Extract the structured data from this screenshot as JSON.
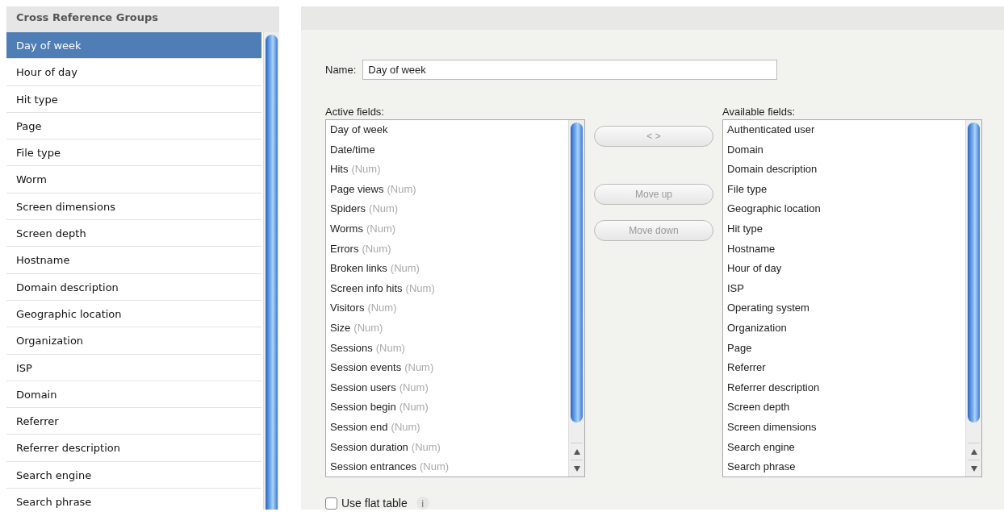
{
  "groups_panel": {
    "title": "Cross Reference Groups",
    "items": [
      {
        "label": "Day of week",
        "selected": true
      },
      {
        "label": "Hour of day",
        "selected": false
      },
      {
        "label": "Hit type",
        "selected": false
      },
      {
        "label": "Page",
        "selected": false
      },
      {
        "label": "File type",
        "selected": false
      },
      {
        "label": "Worm",
        "selected": false
      },
      {
        "label": "Screen dimensions",
        "selected": false
      },
      {
        "label": "Screen depth",
        "selected": false
      },
      {
        "label": "Hostname",
        "selected": false
      },
      {
        "label": "Domain description",
        "selected": false
      },
      {
        "label": "Geographic location",
        "selected": false
      },
      {
        "label": "Organization",
        "selected": false
      },
      {
        "label": "ISP",
        "selected": false
      },
      {
        "label": "Domain",
        "selected": false
      },
      {
        "label": "Referrer",
        "selected": false
      },
      {
        "label": "Referrer description",
        "selected": false
      },
      {
        "label": "Search engine",
        "selected": false
      },
      {
        "label": "Search phrase",
        "selected": false
      }
    ]
  },
  "editor": {
    "name_label": "Name:",
    "name_value": "Day of week",
    "active_label": "Active fields:",
    "active_fields": [
      {
        "label": "Day of week"
      },
      {
        "label": "Date/time"
      },
      {
        "label": "Hits",
        "suffix": "(Num)"
      },
      {
        "label": "Page views",
        "suffix": "(Num)"
      },
      {
        "label": "Spiders",
        "suffix": "(Num)"
      },
      {
        "label": "Worms",
        "suffix": "(Num)"
      },
      {
        "label": "Errors",
        "suffix": "(Num)"
      },
      {
        "label": "Broken links",
        "suffix": "(Num)"
      },
      {
        "label": "Screen info hits",
        "suffix": "(Num)"
      },
      {
        "label": "Visitors",
        "suffix": "(Num)"
      },
      {
        "label": "Size",
        "suffix": "(Num)"
      },
      {
        "label": "Sessions",
        "suffix": "(Num)"
      },
      {
        "label": "Session events",
        "suffix": "(Num)"
      },
      {
        "label": "Session users",
        "suffix": "(Num)"
      },
      {
        "label": "Session begin",
        "suffix": "(Num)"
      },
      {
        "label": "Session end",
        "suffix": "(Num)"
      },
      {
        "label": "Session duration",
        "suffix": "(Num)"
      },
      {
        "label": "Session entrances",
        "suffix": "(Num)"
      }
    ],
    "buttons": [
      {
        "label": "< >",
        "disabled": true
      },
      {
        "label": "Move up",
        "disabled": true
      },
      {
        "label": "Move down",
        "disabled": true
      }
    ],
    "available_label": "Available fields:",
    "available_fields": [
      {
        "label": "Authenticated user"
      },
      {
        "label": "Domain"
      },
      {
        "label": "Domain description"
      },
      {
        "label": "File type"
      },
      {
        "label": "Geographic location"
      },
      {
        "label": "Hit type"
      },
      {
        "label": "Hostname"
      },
      {
        "label": "Hour of day"
      },
      {
        "label": "ISP"
      },
      {
        "label": "Operating system"
      },
      {
        "label": "Organization"
      },
      {
        "label": "Page"
      },
      {
        "label": "Referrer"
      },
      {
        "label": "Referrer description"
      },
      {
        "label": "Screen depth"
      },
      {
        "label": "Screen dimensions"
      },
      {
        "label": "Search engine"
      },
      {
        "label": "Search phrase"
      }
    ],
    "flat_table": {
      "label": "Use flat table",
      "checked": false,
      "info": "i"
    }
  }
}
